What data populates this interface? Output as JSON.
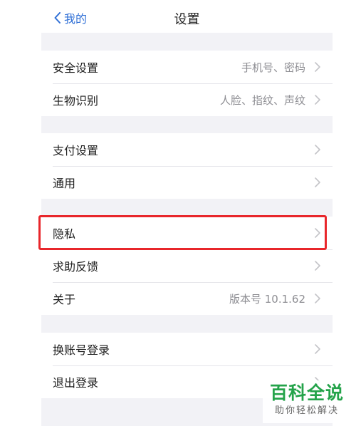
{
  "nav": {
    "back_label": "我的",
    "title": "设置"
  },
  "groups": [
    {
      "items": [
        {
          "label": "安全设置",
          "value": "手机号、密码"
        },
        {
          "label": "生物识别",
          "value": "人脸、指纹、声纹"
        }
      ]
    },
    {
      "items": [
        {
          "label": "支付设置",
          "value": ""
        },
        {
          "label": "通用",
          "value": ""
        }
      ]
    },
    {
      "items": [
        {
          "label": "隐私",
          "value": ""
        },
        {
          "label": "求助反馈",
          "value": ""
        },
        {
          "label": "关于",
          "value": "版本号 10.1.62"
        }
      ]
    },
    {
      "items": [
        {
          "label": "换账号登录",
          "value": ""
        },
        {
          "label": "退出登录",
          "value": ""
        }
      ]
    }
  ],
  "highlight_color": "#e8262b",
  "accent_color": "#2f6fd6",
  "watermark": {
    "logo": "百科全说",
    "tagline": "助你轻松解决"
  }
}
